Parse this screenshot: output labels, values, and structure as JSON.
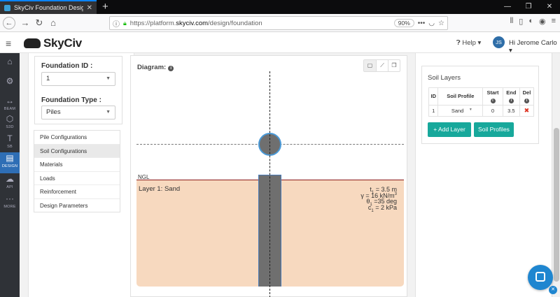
{
  "browser": {
    "tab_title": "SkyCiv Foundation Design | Sky",
    "url_prefix": "https://platform.",
    "url_domain": "skyciv.com",
    "url_path": "/design/foundation",
    "zoom": "90%"
  },
  "header": {
    "logo": "SkyCiv",
    "help": "Help",
    "user_initials": "JS",
    "user_name": "Hi Jerome Carlo"
  },
  "leftnav": {
    "items": [
      {
        "label": "",
        "icon": "home-icon"
      },
      {
        "label": "",
        "icon": "gear-icon"
      },
      {
        "label": "BEAM",
        "icon": "beam-icon"
      },
      {
        "label": "S3D",
        "icon": "cube-icon"
      },
      {
        "label": "SB",
        "icon": "section-icon"
      },
      {
        "label": "DESIGN",
        "icon": "document-icon"
      },
      {
        "label": "API",
        "icon": "cloud-icon"
      },
      {
        "label": "MORE",
        "icon": "more-icon"
      }
    ]
  },
  "form": {
    "id_label": "Foundation ID :",
    "id_value": "1",
    "type_label": "Foundation Type :",
    "type_value": "Piles"
  },
  "menu": {
    "items": [
      "Pile Configurations",
      "Soil Configurations",
      "Materials",
      "Loads",
      "Reinforcement",
      "Design Parameters"
    ],
    "active": "Soil Configurations"
  },
  "diagram": {
    "title": "Diagram:",
    "ngl": "NGL",
    "layer_name": "Layer 1: Sand",
    "t_val": " = 3.5 m",
    "gamma_val": " = 16 kN/m",
    "theta_val": " =35 deg",
    "c_val": " = 2 kPa"
  },
  "soil_layers": {
    "title": "Soil Layers",
    "columns": [
      "ID",
      "Soil Profile",
      "Start",
      "End",
      "Del"
    ],
    "rows": [
      {
        "id": "1",
        "profile": "Sand",
        "start": "0",
        "end": "3.5"
      }
    ],
    "add_button": "+ Add Layer",
    "profiles_button": "Soil Profiles"
  },
  "colors": {
    "accent": "#17a89b",
    "nav_active": "#2e6eb5",
    "soil_fill": "#f7d9bf",
    "pile": "#6f6f6f"
  }
}
